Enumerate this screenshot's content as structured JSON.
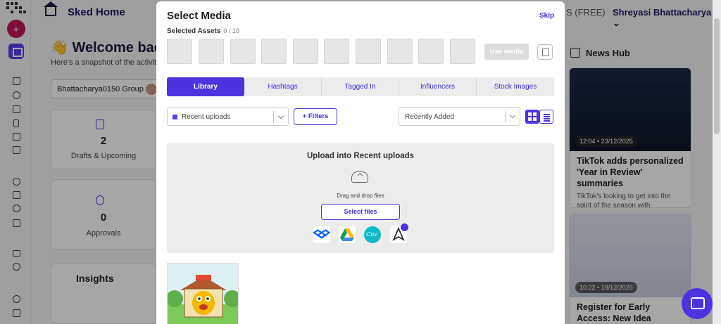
{
  "app": {
    "title": "Sked Home",
    "plan": "S (FREE)",
    "user": "Shreyasi Bhattacharya"
  },
  "dashboard": {
    "welcome": "Welcome bac",
    "snapshot": "Here's a snapshot of the activiti",
    "group": "Bhattacharya0150 Group",
    "cards": [
      {
        "count": "2",
        "label": "Drafts & Upcoming"
      },
      {
        "count": "0",
        "label": "Approvals"
      }
    ],
    "insights_title": "Insights"
  },
  "news": {
    "title": "News Hub",
    "items": [
      {
        "timestamp": "12:04 • 23/12/2025",
        "headline": "TikTok adds personalized 'Year in Review' summaries",
        "summary": "TikTok's looking to get into the spirit of the season with seasonal..."
      },
      {
        "timestamp": "10:22 • 19/12/2025",
        "headline": "Register for Early Access: New Idea Planner",
        "summary": ""
      }
    ]
  },
  "modal": {
    "title": "Select Media",
    "skip_label": "Skip",
    "selected_label": "Selected Assets",
    "selected_count": "0 / 10",
    "slots": 10,
    "use_media_label": "Use media",
    "tabs": [
      {
        "label": "Library",
        "active": true
      },
      {
        "label": "Hashtags",
        "active": false
      },
      {
        "label": "Tagged In",
        "active": false
      },
      {
        "label": "Influencers",
        "active": false
      },
      {
        "label": "Stock Images",
        "active": false
      }
    ],
    "folder_value": "Recent uploads",
    "filters_label": "+ Filters",
    "sort_value": "Recently Added",
    "upload_title": "Upload into Recent uploads",
    "drag_text": "Drag and drop files",
    "select_files_label": "Select files",
    "services": [
      "dropbox-icon",
      "google-drive-icon",
      "canva-icon",
      "other-source-icon"
    ]
  },
  "colors": {
    "accent": "#4b34e0",
    "accent_text": "#3b2fd6",
    "brand_pink": "#c2185b"
  }
}
